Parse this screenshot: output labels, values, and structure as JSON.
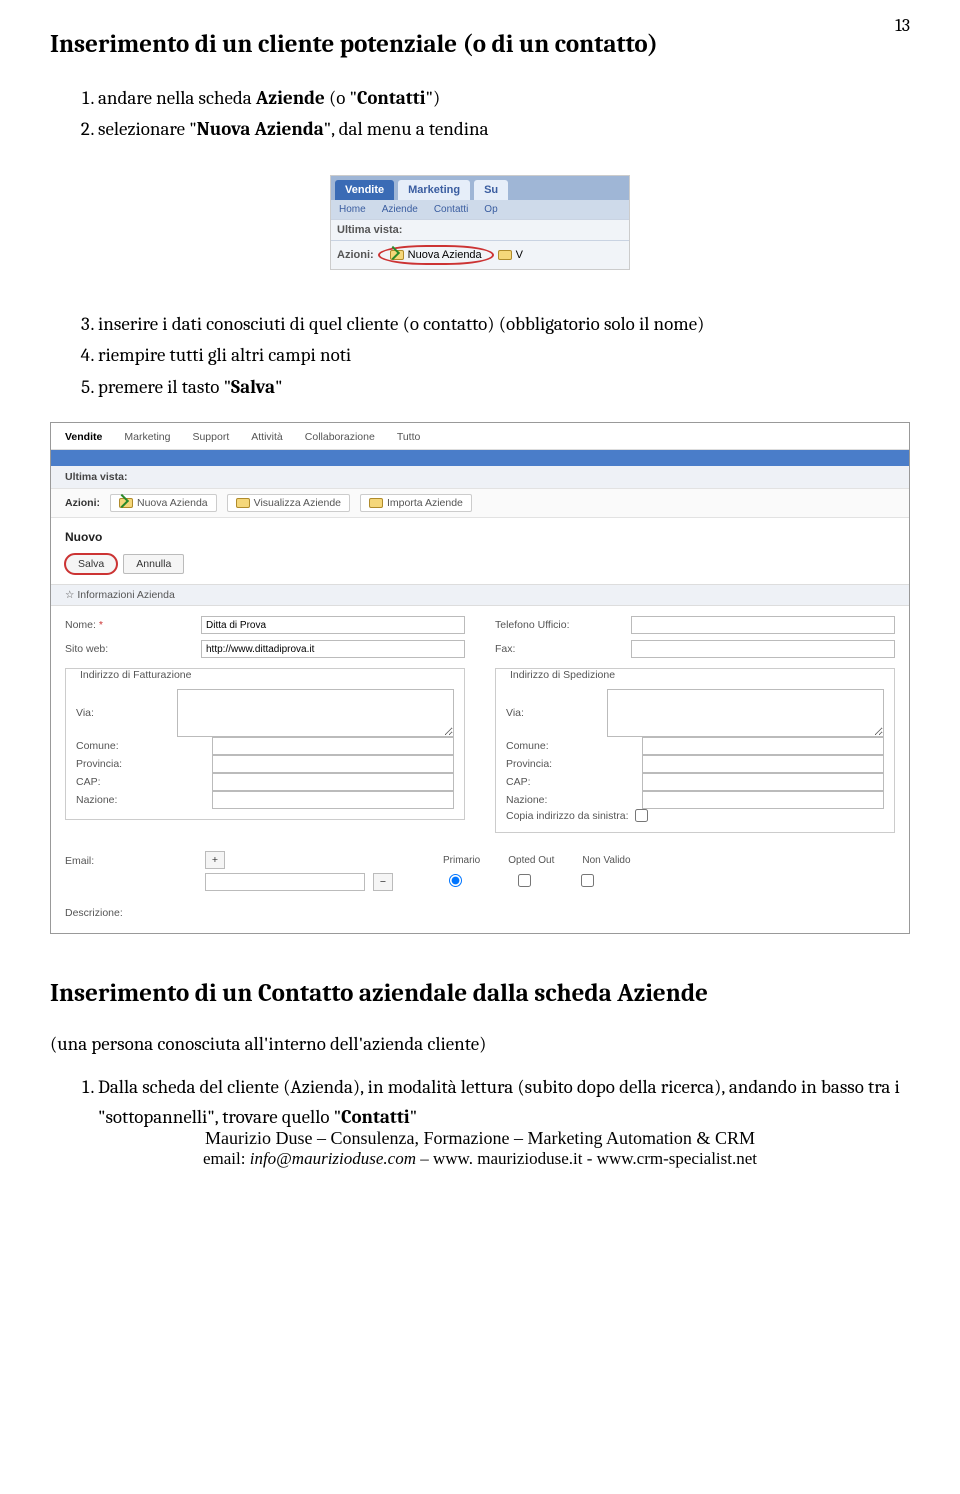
{
  "page_number": "13",
  "h1": "Inserimento di un cliente potenziale (o di un contatto)",
  "steps1": {
    "s1": "andare nella scheda ",
    "s1b1": "Aziende",
    "s1m": " (o \"",
    "s1b2": "Contatti",
    "s1e": "\")",
    "s2": "selezionare \"",
    "s2b": "Nuova Azienda",
    "s2e": "\", dal menu a tendina",
    "s3": "inserire i dati conosciuti di quel cliente (o contatto) (obbligatorio solo il nome)",
    "s4": "riempire tutti gli altri campi noti",
    "s5": "premere il tasto \"",
    "s5b": "Salva",
    "s5e": "\""
  },
  "img1": {
    "tab_vendite": "Vendite",
    "tab_marketing": "Marketing",
    "tab_su": "Su",
    "sub_home": "Home",
    "sub_aziende": "Aziende",
    "sub_contatti": "Contatti",
    "sub_op": "Op",
    "ultima": "Ultima vista:",
    "azioni": "Azioni:",
    "nuova": "Nuova Azienda",
    "v": "V"
  },
  "img2": {
    "tabs": [
      "Vendite",
      "Marketing",
      "Support",
      "Attività",
      "Collaborazione",
      "Tutto"
    ],
    "ultima": "Ultima vista:",
    "azioni": "Azioni:",
    "chip1": "Nuova Azienda",
    "chip2": "Visualizza Aziende",
    "chip3": "Importa Aziende",
    "nuovo": "Nuovo",
    "salva": "Salva",
    "annulla": "Annulla",
    "section_info": "☆ Informazioni Azienda",
    "nome": "Nome:",
    "nome_val": "Ditta di Prova",
    "sito": "Sito web:",
    "sito_val": "http://www.dittadiprova.it",
    "telefono": "Telefono Ufficio:",
    "fax": "Fax:",
    "fs_fatt": "Indirizzo di Fatturazione",
    "fs_sped": "Indirizzo di Spedizione",
    "via": "Via:",
    "comune": "Comune:",
    "provincia": "Provincia:",
    "cap": "CAP:",
    "nazione": "Nazione:",
    "copia": "Copia indirizzo da sinistra:",
    "email": "Email:",
    "primario": "Primario",
    "opted": "Opted Out",
    "nonvalido": "Non Valido",
    "descrizione": "Descrizione:"
  },
  "h2": "Inserimento di un Contatto aziendale dalla scheda Aziende",
  "h2_sub": "(una persona conosciuta all'interno dell'azienda cliente)",
  "steps2": {
    "s1a": "Dalla scheda del cliente (Azienda), in modalità lettura (subito dopo della ricerca), andando in basso tra i \"sottopannelli\", trovare quello \"",
    "s1b": "Contatti",
    "s1e": "\""
  },
  "footer": {
    "line1": "Maurizio Duse – Consulenza, Formazione – Marketing Automation & CRM",
    "line2_pre": "email: ",
    "line2_em": "info@maurizioduse.com",
    "line2_mid": " – www. maurizioduse.it  -  www.crm-specialist.net"
  }
}
